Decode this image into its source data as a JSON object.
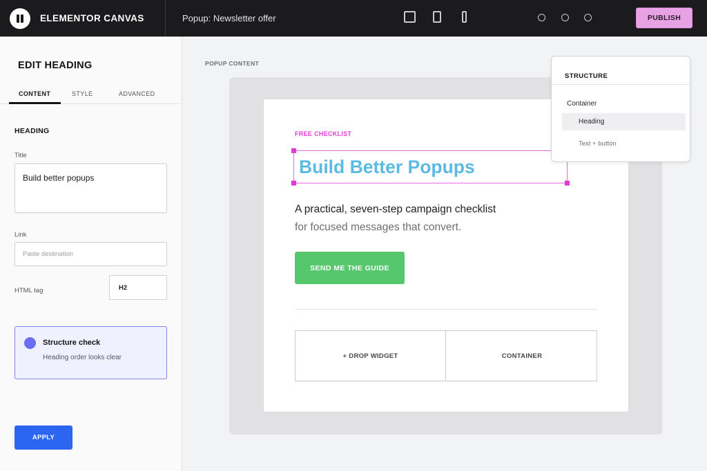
{
  "app": {
    "brand": "ELEMENTOR CANVAS",
    "document_title": "Popup: Newsletter offer",
    "publish_label": "PUBLISH",
    "icons": {
      "logo": "pause-logo-icon",
      "devices": [
        "desktop-icon",
        "tablet-icon",
        "mobile-icon"
      ],
      "status_dots": [
        "circle-icon",
        "circle-icon",
        "circle-icon"
      ]
    },
    "colors": {
      "topbar": "#1b1b1e",
      "publish": "#e7a2e6"
    }
  },
  "panel": {
    "title": "EDIT HEADING",
    "tabs": [
      "CONTENT",
      "STYLE",
      "ADVANCED"
    ],
    "active_tab": "CONTENT",
    "section": "HEADING",
    "fields": {
      "title_label": "Title",
      "title_value": "Build better popups",
      "link_label": "Link",
      "link_placeholder": "Paste destination",
      "tag_label": "HTML tag",
      "tag_value": "H2"
    },
    "check": {
      "title": "Structure check",
      "message": "Heading order looks clear"
    },
    "apply_label": "APPLY",
    "colors": {
      "apply": "#2c66f0",
      "check_accent": "#6b6ef0"
    }
  },
  "canvas": {
    "label": "POPUP CONTENT",
    "popup": {
      "eyebrow": "FREE CHECKLIST",
      "heading": "Build Better Popups",
      "body_line1": "A practical, seven-step campaign checklist",
      "body_line2": "for focused messages that convert.",
      "cta_label": "SEND ME THE GUIDE",
      "columns": [
        "+  DROP WIDGET",
        "CONTAINER"
      ]
    },
    "colors": {
      "eyebrow": "#e23ad6",
      "heading": "#5dbbe3",
      "cta": "#57c76d",
      "selection": "#e56ae0"
    }
  },
  "navigator": {
    "title": "STRUCTURE",
    "items": [
      {
        "label": "Container",
        "selected": false
      },
      {
        "label": "Heading",
        "selected": true
      },
      {
        "label": "Text + button",
        "selected": false
      }
    ]
  }
}
